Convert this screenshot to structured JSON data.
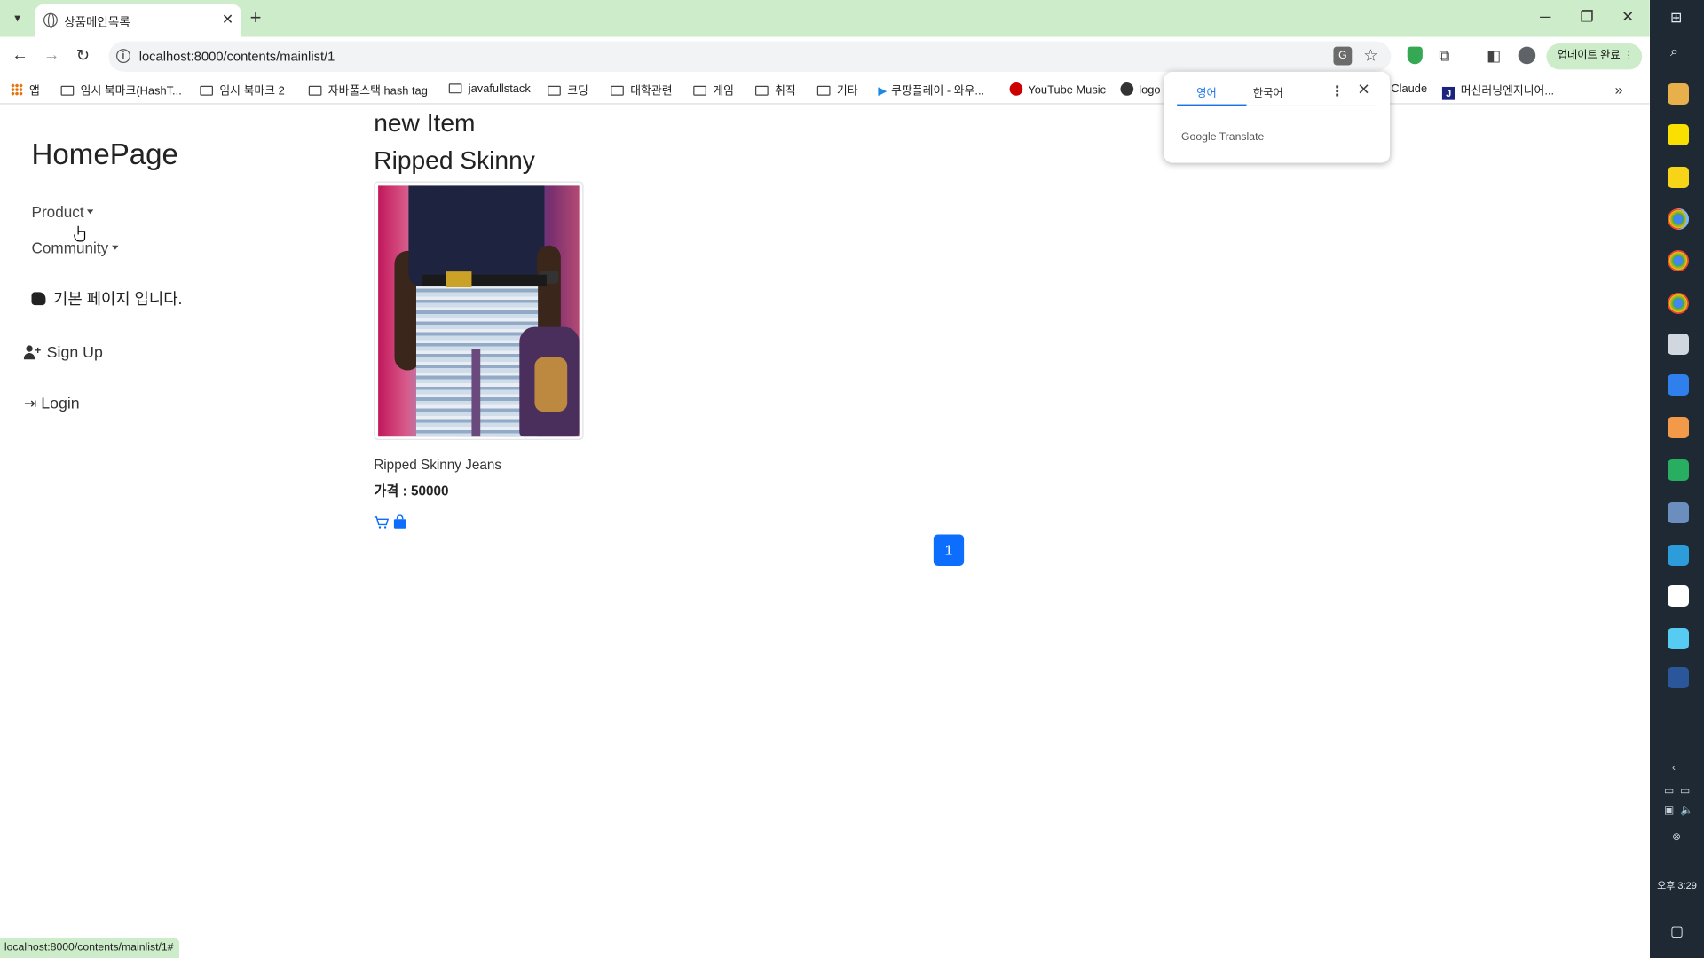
{
  "browser": {
    "tab_title": "상품메인목록",
    "url": "localhost:8000/contents/mainlist/1",
    "status_url": "localhost:8000/contents/mainlist/1#",
    "update_label": "업데이트 완료",
    "bookmarks": [
      {
        "label": "앱",
        "type": "apps"
      },
      {
        "label": "임시 북마크(HashT...",
        "type": "folder"
      },
      {
        "label": "임시 북마크 2",
        "type": "folder"
      },
      {
        "label": "자바풀스택 hash tag",
        "type": "folder"
      },
      {
        "label": "javafullstack",
        "type": "folder"
      },
      {
        "label": "코딩",
        "type": "folder"
      },
      {
        "label": "대학관련",
        "type": "folder"
      },
      {
        "label": "게임",
        "type": "folder"
      },
      {
        "label": "취직",
        "type": "folder"
      },
      {
        "label": "기타",
        "type": "folder"
      },
      {
        "label": "쿠팡플레이 - 와우...",
        "type": "link"
      },
      {
        "label": "YouTube Music",
        "type": "link"
      },
      {
        "label": "logo",
        "type": "link"
      },
      {
        "label": "Claude",
        "type": "link"
      },
      {
        "label": "머신러닝엔지니어...",
        "type": "link"
      }
    ]
  },
  "translate_popup": {
    "tab_source": "영어",
    "tab_target": "한국어",
    "brand": "Google Translate"
  },
  "sidebar": {
    "site_title": "HomePage",
    "menu": [
      "Product",
      "Community"
    ],
    "note": "기본 페이지 입니다.",
    "signup": "Sign Up",
    "login": "Login"
  },
  "main": {
    "heading": "new Item",
    "subheading": "Ripped Skinny",
    "product": {
      "name": "Ripped Skinny Jeans",
      "price": "가격 : 50000"
    },
    "pagination": [
      "1"
    ]
  },
  "taskbar": {
    "time": "오후 3:29"
  },
  "colors": {
    "tab_bar": "#cdecc9",
    "primary": "#0d6efd",
    "taskbar": "#1f2933"
  }
}
